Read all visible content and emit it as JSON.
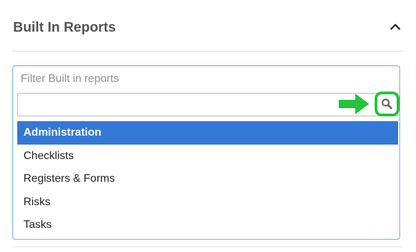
{
  "section": {
    "title": "Built In Reports",
    "toggle_icon": "chevron-up-icon"
  },
  "filter": {
    "label": "Filter Built in reports",
    "value": "",
    "placeholder": "",
    "search_icon": "search-icon",
    "highlight_color": "#25c23c",
    "arrow_icon": "arrow-right-icon"
  },
  "options": [
    {
      "label": "Administration",
      "selected": true
    },
    {
      "label": "Checklists",
      "selected": false
    },
    {
      "label": "Registers & Forms",
      "selected": false
    },
    {
      "label": "Risks",
      "selected": false
    },
    {
      "label": "Tasks",
      "selected": false
    }
  ],
  "colors": {
    "selected_bg": "#3478d6",
    "dropdown_border": "#6fa7de",
    "title_text": "#555555"
  }
}
